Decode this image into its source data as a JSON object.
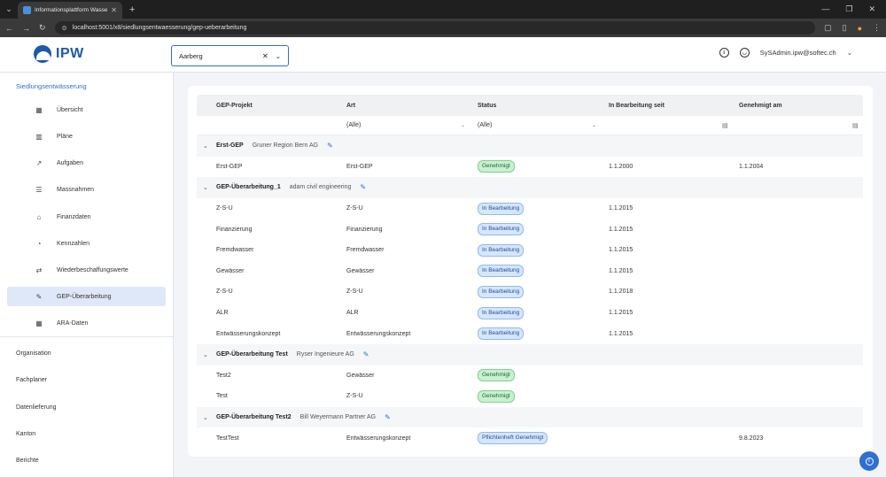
{
  "browser": {
    "tab_title": "Informationsplattform Wasser",
    "url": "localhost:5001/x8/siedlungsentwaesserung/gep-ueberarbeitung"
  },
  "header": {
    "logo_text": "IPW",
    "selector_value": "Aarberg",
    "user": "SySAdmin.ipw@softec.ch"
  },
  "sidebar": {
    "section": "Siedlungsentwässerung",
    "items": [
      {
        "label": "Übersicht",
        "icon": "grid-icon"
      },
      {
        "label": "Pläne",
        "icon": "map-icon"
      },
      {
        "label": "Aufgaben",
        "icon": "arrow-icon"
      },
      {
        "label": "Massnahmen",
        "icon": "checklist-icon"
      },
      {
        "label": "Finanzdaten",
        "icon": "bank-icon"
      },
      {
        "label": "Kennzahlen",
        "icon": "piggy-icon"
      },
      {
        "label": "Wiederbeschaffungswerte",
        "icon": "swap-icon"
      },
      {
        "label": "GEP-Überarbeitung",
        "icon": "edit-icon"
      },
      {
        "label": "ARA-Daten",
        "icon": "table-icon"
      }
    ],
    "top_items": [
      "Organisation",
      "Fachplaner",
      "Datenlieferung",
      "Kanton",
      "Berichte"
    ]
  },
  "table": {
    "headers": [
      "GEP-Projekt",
      "Art",
      "Status",
      "In Bearbeitung seit",
      "Genehmigt am"
    ],
    "filter_all": "(Alle)",
    "groups": [
      {
        "name": "Erst-GEP",
        "firm": "Gruner Region Bern AG",
        "rows": [
          {
            "projekt": "Erst-GEP",
            "art": "Erst-GEP",
            "status": "Genehmigt",
            "seit": "1.1.2000",
            "genehmigt": "1.1.2004"
          }
        ]
      },
      {
        "name": "GEP-Überarbeitung_1",
        "firm": "adam civil engineering",
        "rows": [
          {
            "projekt": "Z-S-U",
            "art": "Z-S-U",
            "status": "In Bearbeitung",
            "seit": "1.1.2015",
            "genehmigt": ""
          },
          {
            "projekt": "Finanzierung",
            "art": "Finanzierung",
            "status": "In Bearbeitung",
            "seit": "1.1.2015",
            "genehmigt": ""
          },
          {
            "projekt": "Fremdwasser",
            "art": "Fremdwasser",
            "status": "In Bearbeitung",
            "seit": "1.1.2015",
            "genehmigt": ""
          },
          {
            "projekt": "Gewässer",
            "art": "Gewässer",
            "status": "In Bearbeitung",
            "seit": "1.1.2015",
            "genehmigt": ""
          },
          {
            "projekt": "Z-S-U",
            "art": "Z-S-U",
            "status": "In Bearbeitung",
            "seit": "1.1.2018",
            "genehmigt": ""
          },
          {
            "projekt": "ALR",
            "art": "ALR",
            "status": "In Bearbeitung",
            "seit": "1.1.2015",
            "genehmigt": ""
          },
          {
            "projekt": "Entwässerungskonzept",
            "art": "Entwässerungskonzept",
            "status": "In Bearbeitung",
            "seit": "1.1.2015",
            "genehmigt": ""
          }
        ]
      },
      {
        "name": "GEP-Überarbeitung Test",
        "firm": "Ryser Ingenieure AG",
        "rows": [
          {
            "projekt": "Test2",
            "art": "Gewässer",
            "status": "Genehmigt",
            "seit": "",
            "genehmigt": ""
          },
          {
            "projekt": "Test",
            "art": "Z-S-U",
            "status": "Genehmigt",
            "seit": "",
            "genehmigt": ""
          }
        ]
      },
      {
        "name": "GEP-Überarbeitung Test2",
        "firm": "Bill Weyermann Partner AG",
        "rows": [
          {
            "projekt": "TestTest",
            "art": "Entwässerungskonzept",
            "status": "Pflichtenheft Genehmigt",
            "seit": "",
            "genehmigt": "9.8.2023"
          }
        ]
      }
    ]
  }
}
